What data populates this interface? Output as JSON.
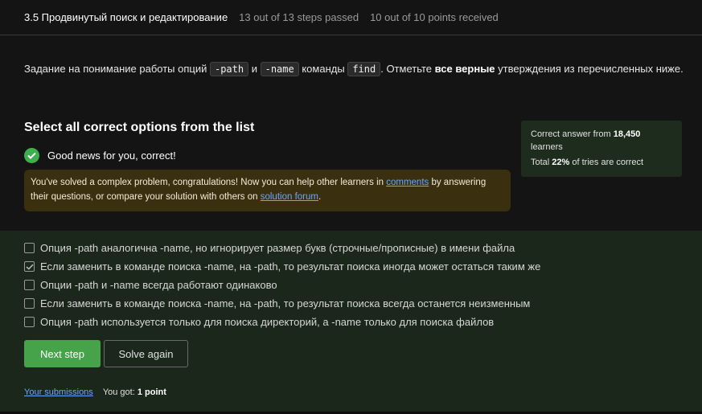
{
  "header": {
    "step_title": "3.5 Продвинутый поиск и редактирование",
    "steps_passed": "13 out of 13 steps passed",
    "points": "10 out of 10 points  received"
  },
  "task": {
    "t1": "Задание на понимание работы опций ",
    "code1": "-path",
    "t2": " и ",
    "code2": "-name",
    "t3": " команды ",
    "code3": "find",
    "t4": ". Отметьте ",
    "bold": "все верные",
    "t5": " утверждения из перечисленных ниже."
  },
  "quiz": {
    "title": "Select all correct options from the list",
    "correct_text": "Good news for you, correct!",
    "congrats": {
      "p1": "You've solved a complex problem, congratulations! Now you can help other learners in ",
      "comments_link": "comments",
      "p2": " by answering their questions, or compare your solution with others on ",
      "forum_link": "solution forum",
      "p3": "."
    }
  },
  "stats": {
    "l1_prefix": "Correct answer from ",
    "learners_count": "18,450",
    "l1_suffix": " learners",
    "l2_prefix": "Total ",
    "percent": "22%",
    "l2_suffix": " of tries are correct"
  },
  "options": [
    {
      "label": "Опция -path аналогична -name, но игнорирует размер букв (строчные/прописные) в имени файла",
      "checked": false
    },
    {
      "label": "Если заменить в команде поиска -name, на -path, то результат поиска иногда может остаться таким же",
      "checked": true
    },
    {
      "label": "Опции -path и -name всегда работают одинаково",
      "checked": false
    },
    {
      "label": "Если заменить в команде поиска -name, на -path, то результат поиска всегда останется неизменным",
      "checked": false
    },
    {
      "label": "Опция -path используется только для поиска директорий, а -name только для поиска файлов",
      "checked": false
    }
  ],
  "buttons": {
    "next": "Next step",
    "again": "Solve again"
  },
  "footer": {
    "submissions": "Your submissions",
    "got_prefix": "You got: ",
    "got_value": "1 point"
  },
  "colors": {
    "accent_green": "#47a34a",
    "link_blue": "#6aa7ff",
    "congrats_bg": "#3a2f0e",
    "options_bg": "#1b271b"
  }
}
